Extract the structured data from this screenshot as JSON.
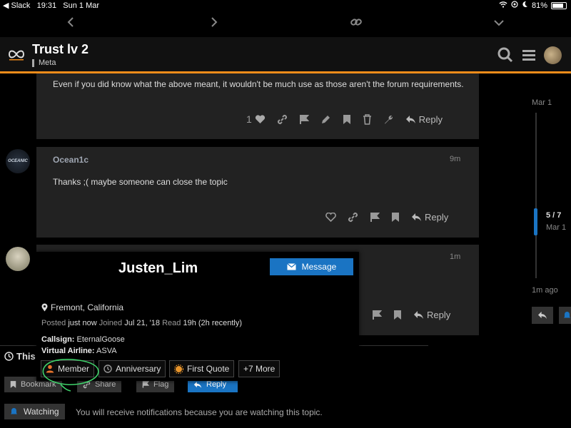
{
  "status_bar": {
    "back_app": "◀ Slack",
    "time": "19:31",
    "date": "Sun 1 Mar",
    "battery": "81%"
  },
  "header": {
    "title": "Trust lv 2",
    "category": "Meta"
  },
  "posts": [
    {
      "text": "Even if you did know what the above meant, it wouldn't be much use as those aren't the forum requirements.",
      "like_count": "1",
      "reply_label": "Reply"
    },
    {
      "author": "Ocean1c",
      "time": "9m",
      "text": "Thanks ;( maybe someone can close the topic",
      "reply_label": "Reply",
      "avatar_text": "OCEANIC"
    },
    {
      "time": "1m",
      "reply_label": "Reply"
    }
  ],
  "timeline": {
    "start_date": "Mar 1",
    "position": "5 / 7",
    "position_date": "Mar 1",
    "end_label": "1m ago"
  },
  "user_card": {
    "name": "Justen_Lim",
    "message_label": "Message",
    "location": "Fremont, California",
    "posted_label": "Posted",
    "posted_value": "just now",
    "joined_label": "Joined",
    "joined_value": "Jul 21, '18",
    "read_label": "Read",
    "read_value": "19h (2h recently)",
    "fields": [
      {
        "label": "Callsign:",
        "value": "EternalGoose"
      },
      {
        "label": "Virtual Airline:",
        "value": "ASVA"
      }
    ],
    "badges": [
      {
        "label": "Member",
        "color": "#e8742c"
      },
      {
        "label": "Anniversary",
        "color": "#999999"
      },
      {
        "label": "First Quote",
        "color": "#e8952c"
      },
      {
        "label": "+7 More"
      }
    ]
  },
  "footer": {
    "section_title": "This",
    "buttons": [
      "Bookmark",
      "Share",
      "Flag",
      "Reply"
    ],
    "watching_label": "Watching",
    "notification_text": "You will receive notifications because you are watching this topic."
  },
  "colors": {
    "accent": "#f28c1a",
    "primary": "#1a74c3",
    "annotation": "#3fd16a"
  }
}
